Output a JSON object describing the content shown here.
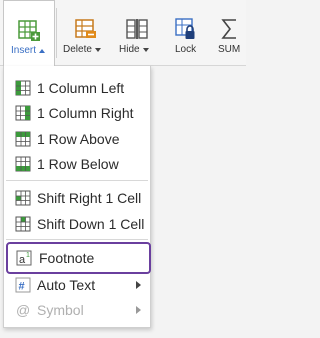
{
  "toolbar": {
    "insert_label": "Insert",
    "delete_label": "Delete",
    "hide_label": "Hide",
    "lock_label": "Lock",
    "sum_label": "SUM"
  },
  "menu": {
    "items": [
      {
        "label": "1 Column Left",
        "icon": "insert-column-left-icon"
      },
      {
        "label": "1 Column Right",
        "icon": "insert-column-right-icon"
      },
      {
        "label": "1 Row Above",
        "icon": "insert-row-above-icon"
      },
      {
        "label": "1 Row Below",
        "icon": "insert-row-below-icon"
      },
      {
        "label": "Shift Right 1 Cell",
        "icon": "shift-right-icon"
      },
      {
        "label": "Shift Down 1 Cell",
        "icon": "shift-down-icon"
      },
      {
        "label": "Footnote",
        "icon": "footnote-icon",
        "selected": true
      },
      {
        "label": "Auto Text",
        "icon": "auto-text-icon",
        "submenu": true
      },
      {
        "label": "Symbol",
        "icon": "symbol-icon",
        "submenu": true,
        "disabled": true
      }
    ]
  },
  "colors": {
    "accent": "#3a6fc4",
    "selection_border": "#6a3f9e",
    "icon_green": "#3c9a3c",
    "icon_orange": "#e08a1a"
  }
}
